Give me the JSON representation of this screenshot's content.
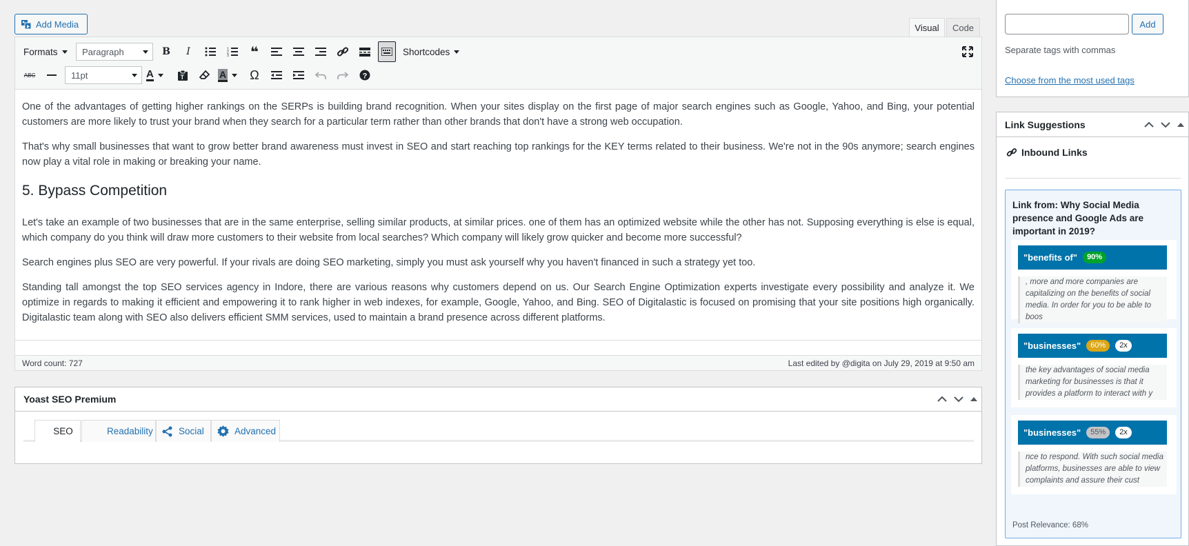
{
  "editor": {
    "add_media_label": "Add Media",
    "tab_visual": "Visual",
    "tab_code": "Code",
    "toolbar": {
      "formats_label": "Formats",
      "paragraph_select": "Paragraph",
      "fontsize_select": "11pt",
      "shortcodes_label": "Shortcodes"
    },
    "content": {
      "p1": "One of the advantages of getting higher rankings on the SERPs is building brand recognition. When your sites display on the first page of major search engines such as Google, Yahoo, and Bing, your potential customers are more likely to trust your brand when they search for a particular term rather than other brands that don't have a strong web occupation.",
      "p2": "That's why small businesses that want to grow better brand awareness must invest in SEO and start reaching top rankings for the KEY terms related to their business. We're not in the 90s anymore; search engines now play a vital role in making or breaking your name.",
      "h2": "5. Bypass Competition",
      "p3": "Let's take an example of two businesses that are in the same enterprise, selling similar products, at similar prices. one of them has an optimized website while the other has not. Supposing everything is else is equal, which company do you think will draw more customers to their website from local searches? Which company will likely grow quicker and become more successful?",
      "p4": "Search engines plus SEO are very powerful. If your rivals are doing SEO marketing, simply you must ask yourself why you haven't financed in such a strategy yet too.",
      "p5": "Standing tall amongst the top SEO services agency in Indore, there are various reasons why customers depend on us. Our Search Engine Optimization experts investigate every possibility and analyze it. We optimize in regards to making it efficient and empowering it to rank higher in web indexes, for example, Google, Yahoo, and Bing. SEO of Digitalastic is focused on promising that your site positions high organically. Digitalastic team along with SEO also delivers efficient SMM services, used to maintain a brand presence across different platforms."
    },
    "word_count": "Word count: 727",
    "last_edited": "Last edited by @digita on July 29, 2019 at 9:50 am"
  },
  "yoast": {
    "title": "Yoast SEO Premium",
    "tabs": [
      "SEO",
      "Readability",
      "Social",
      "Advanced"
    ]
  },
  "tags": {
    "add_label": "Add",
    "hint": "Separate tags with commas",
    "most_used_link": "Choose from the most used tags"
  },
  "link_suggestions": {
    "title": "Link Suggestions",
    "inbound_label": "Inbound Links",
    "link_from": "Link from: Why Social Media presence and Google Ads are important in 2019?",
    "suggestions": [
      {
        "keyword": "\"benefits of\"",
        "score": "90%",
        "count": "",
        "snippet": ", more and more companies are capitalizing on the benefits of social media. In order for you to be able to boos"
      },
      {
        "keyword": "\"businesses\"",
        "score": "60%",
        "count": "2x",
        "snippet": "the key advantages of social media marketing for businesses is that it provides a platform to interact with y"
      },
      {
        "keyword": "\"businesses\"",
        "score": "55%",
        "count": "2x",
        "snippet": "nce to respond. With such social media platforms, businesses are able to view complaints and assure their cust"
      }
    ],
    "post_relevance": "Post Relevance: 68%"
  },
  "colors": {
    "accent": "#2271b1",
    "suggestion_header": "#0073aa",
    "score_high": "#00a32a",
    "score_mid": "#dba617",
    "score_low": "#c3c4c7"
  }
}
